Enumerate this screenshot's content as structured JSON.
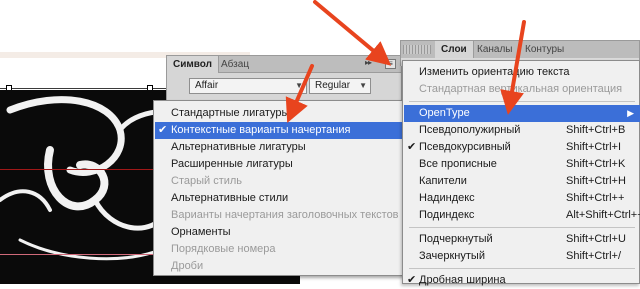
{
  "character_panel": {
    "tabs": [
      "Символ",
      "Абзац"
    ],
    "font_family": "Affair",
    "font_style": "Regular"
  },
  "layers_panel": {
    "tabs": [
      "Слои",
      "Каналы",
      "Контуры"
    ]
  },
  "glyph_menu": {
    "items": [
      {
        "label": "Стандартные лигатуры",
        "enabled": true,
        "checked": false,
        "highlight": false
      },
      {
        "label": "Контекстные варианты начертания",
        "enabled": true,
        "checked": true,
        "highlight": true
      },
      {
        "label": "Альтернативные лигатуры",
        "enabled": true,
        "checked": false,
        "highlight": false
      },
      {
        "label": "Расширенные лигатуры",
        "enabled": true,
        "checked": false,
        "highlight": false
      },
      {
        "label": "Старый стиль",
        "enabled": false,
        "checked": false,
        "highlight": false
      },
      {
        "label": "Альтернативные стили",
        "enabled": true,
        "checked": false,
        "highlight": false
      },
      {
        "label": "Варианты начертания заголовочных текстов",
        "enabled": false,
        "checked": false,
        "highlight": false
      },
      {
        "label": "Орнаменты",
        "enabled": true,
        "checked": false,
        "highlight": false
      },
      {
        "label": "Порядковые номера",
        "enabled": false,
        "checked": false,
        "highlight": false
      },
      {
        "label": "Дроби",
        "enabled": false,
        "checked": false,
        "highlight": false
      }
    ]
  },
  "panel_menu": {
    "items": [
      {
        "label": "Изменить ориентацию текста",
        "shortcut": "",
        "enabled": true
      },
      {
        "label": "Стандартная вертикальная ориентация",
        "shortcut": "",
        "enabled": false
      },
      {
        "label": "OpenType",
        "shortcut": "",
        "enabled": true,
        "highlight": true,
        "submenu": true
      },
      {
        "label": "Псевдополужирный",
        "shortcut": "Shift+Ctrl+B",
        "enabled": true
      },
      {
        "label": "Псевдокурсивный",
        "shortcut": "Shift+Ctrl+I",
        "enabled": true,
        "checked": true
      },
      {
        "label": "Все прописные",
        "shortcut": "Shift+Ctrl+K",
        "enabled": true
      },
      {
        "label": "Капители",
        "shortcut": "Shift+Ctrl+H",
        "enabled": true
      },
      {
        "label": "Надиндекс",
        "shortcut": "Shift+Ctrl++",
        "enabled": true
      },
      {
        "label": "Подиндекс",
        "shortcut": "Alt+Shift+Ctrl++",
        "enabled": true
      },
      {
        "label": "Подчеркнутый",
        "shortcut": "Shift+Ctrl+U",
        "enabled": true
      },
      {
        "label": "Зачеркнутый",
        "shortcut": "Shift+Ctrl+/",
        "enabled": true
      },
      {
        "label": "Дробная ширина",
        "shortcut": "",
        "enabled": true,
        "checked": true
      }
    ]
  },
  "colors": {
    "highlight": "#3b6fd8",
    "arrow": "#e8441e",
    "menu_bg": "#f0f0f0"
  }
}
